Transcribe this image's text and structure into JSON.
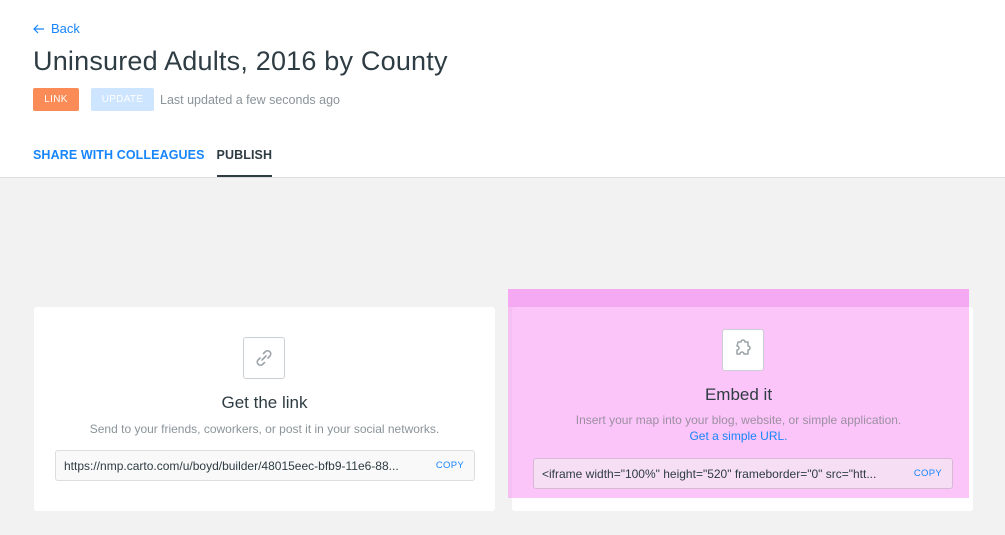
{
  "nav": {
    "back_label": "Back"
  },
  "map": {
    "title": "Uninsured Adults, 2016 by County",
    "link_badge": "LINK",
    "update_badge": "UPDATE",
    "last_updated": "Last updated a few seconds ago"
  },
  "tabs": [
    {
      "label": "SHARE WITH COLLEAGUES",
      "active": false
    },
    {
      "label": "PUBLISH",
      "active": true
    }
  ],
  "link_card": {
    "icon": "link-icon",
    "title": "Get the link",
    "description": "Send to your friends, coworkers, or post it in your social networks.",
    "url": "https://nmp.carto.com/u/boyd/builder/48015eec-bfb9-11e6-88...",
    "copy_label": "COPY"
  },
  "embed_card": {
    "icon": "embed-puzzle-icon",
    "title": "Embed it",
    "description": "Insert your map into your blog, website, or simple application.",
    "simple_url_link": "Get a simple URL.",
    "code": "<iframe width=\"100%\" height=\"520\" frameborder=\"0\" src=\"htt...",
    "copy_label": "COPY"
  },
  "colors": {
    "accent": "#1785fb",
    "link_badge": "#fb8c57",
    "update_badge": "#cde5fe",
    "highlight": "#fa96f5"
  }
}
